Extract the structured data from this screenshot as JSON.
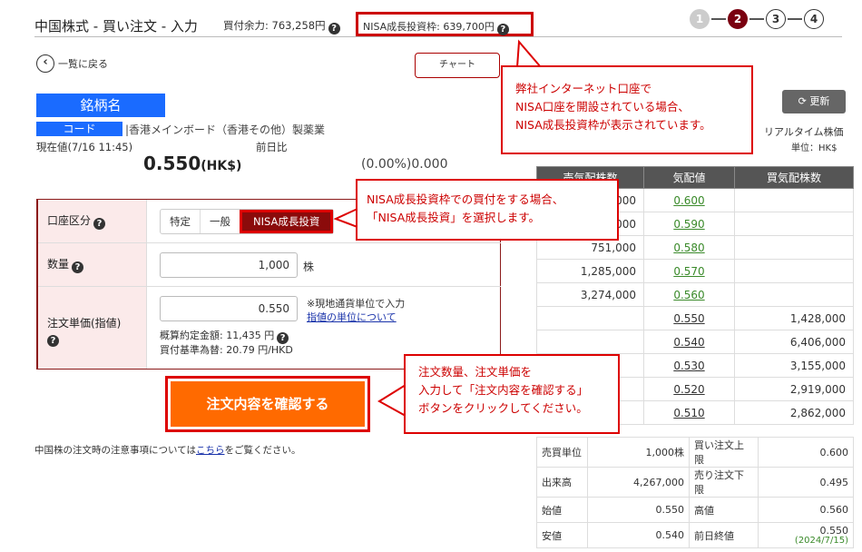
{
  "header": {
    "title": "中国株式 - 買い注文 - 入力",
    "buying_power": "買付余力: 763,258円",
    "nisa_limit": "NISA成長投資枠: 639,700円",
    "steps": [
      "1",
      "2",
      "3",
      "4"
    ]
  },
  "nav": {
    "back": "一覧に戻る",
    "chart": "チャート"
  },
  "stock": {
    "name": "銘柄名",
    "code": "コード",
    "market": "|香港メインボード（香港その他）製薬業",
    "now_label": "現在値(7/16 11:45)",
    "prev_label": "前日比",
    "price": "0.550",
    "currency": "(HK$)",
    "change": "(0.00%)0.000"
  },
  "form": {
    "account_label": "口座区分",
    "account_options": [
      "特定",
      "一般",
      "NISA成長投資"
    ],
    "qty_label": "数量",
    "qty_value": "1,000",
    "qty_unit": "株",
    "price_label": "注文単価(指値)",
    "price_value": "0.550",
    "price_note1": "※現地通貨単位で入力",
    "price_note2": "指値の単位について",
    "est_amount": "概算約定金額: 11,435 円",
    "fx_rate": "買付基準為替: 20.79 円/HKD",
    "confirm": "注文内容を確認する"
  },
  "footer": {
    "note_pre": "中国株の注文時の注意事項については",
    "note_link": "こちら",
    "note_post": "をご覧ください。"
  },
  "right": {
    "refresh": "更新",
    "realtime": "リアルタイム株価",
    "unit": "単位：HK$"
  },
  "book": {
    "headers": [
      "売気配株数",
      "気配値",
      "買気配株数"
    ],
    "rows": [
      {
        "sell": "000",
        "price": "0.600",
        "buy": ""
      },
      {
        "sell": "000",
        "price": "0.590",
        "buy": ""
      },
      {
        "sell": "751,000",
        "price": "0.580",
        "buy": ""
      },
      {
        "sell": "1,285,000",
        "price": "0.570",
        "buy": ""
      },
      {
        "sell": "3,274,000",
        "price": "0.560",
        "buy": ""
      },
      {
        "sell": "",
        "price": "0.550",
        "buy": "1,428,000"
      },
      {
        "sell": "",
        "price": "0.540",
        "buy": "6,406,000"
      },
      {
        "sell": "",
        "price": "0.530",
        "buy": "3,155,000"
      },
      {
        "sell": "",
        "price": "0.520",
        "buy": "2,919,000"
      },
      {
        "sell": "",
        "price": "0.510",
        "buy": "2,862,000"
      }
    ]
  },
  "stats": [
    {
      "k1": "売買単位",
      "v1": "1,000株",
      "k2": "買い注文上限",
      "v2": "0.600"
    },
    {
      "k1": "出来高",
      "v1": "4,267,000",
      "k2": "売り注文下限",
      "v2": "0.495"
    },
    {
      "k1": "始値",
      "v1": "0.550",
      "k2": "高値",
      "v2": "0.560"
    },
    {
      "k1": "安値",
      "v1": "0.540",
      "k2": "前日終値",
      "v2": "0.550",
      "v2sub": "(2024/7/15)"
    }
  ],
  "callouts": {
    "c1": [
      "弊社インターネット口座で",
      "NISA口座を開設されている場合、",
      "NISA成長投資枠が表示されています。"
    ],
    "c2": [
      "NISA成長投資枠での買付をする場合、",
      "「NISA成長投資」を選択します。"
    ],
    "c3": [
      "注文数量、注文単価を",
      "入力して「注文内容を確認する」",
      "ボタンをクリックしてください。"
    ]
  },
  "colors": {
    "accent": "#8b0b0b",
    "callout": "#dd0000",
    "confirm": "#ff6a00",
    "stock_bg": "#1a6bff",
    "green": "#3a8a2a"
  }
}
